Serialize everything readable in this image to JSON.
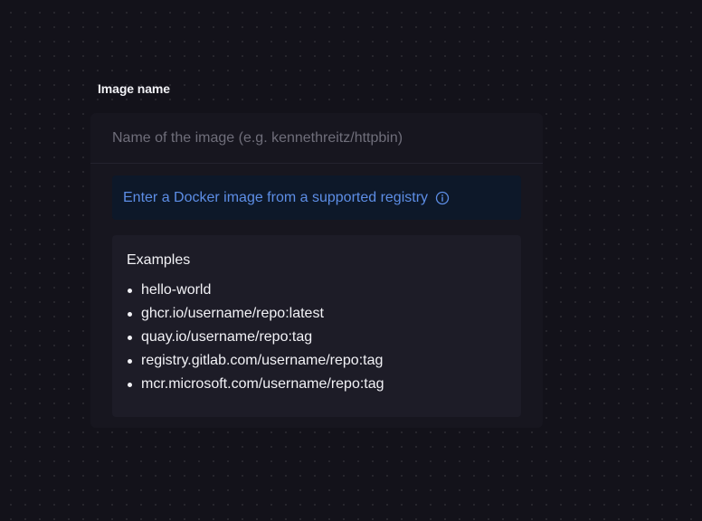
{
  "form": {
    "label": "Image name",
    "input": {
      "value": "",
      "placeholder": "Name of the image (e.g. kennethreitz/httpbin)"
    },
    "info_banner": {
      "text": "Enter a Docker image from a supported registry",
      "icon": "info-icon"
    },
    "examples": {
      "title": "Examples",
      "items": [
        "hello-world",
        "ghcr.io/username/repo:latest",
        "quay.io/username/repo:tag",
        "registry.gitlab.com/username/repo:tag",
        "mcr.microsoft.com/username/repo:tag"
      ]
    }
  },
  "colors": {
    "background": "#13121a",
    "card": "#17161f",
    "info_banner_bg": "#0d1829",
    "info_text": "#5d8ee6",
    "examples_bg": "#1d1c27"
  }
}
